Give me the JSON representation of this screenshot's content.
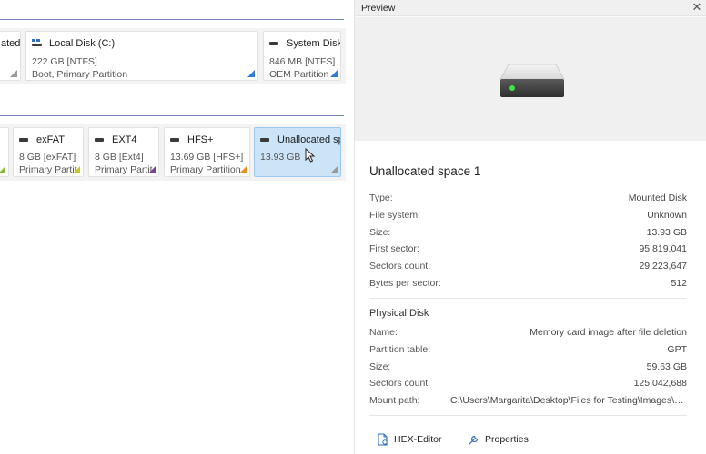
{
  "disk_map": {
    "disk1_partitions": [
      {
        "name": "",
        "line1": "ated",
        "line2": "",
        "icon": "drive-icon"
      },
      {
        "name": "Local Disk (C:)",
        "line1": "222 GB [NTFS]",
        "line2": "Boot, Primary Partition",
        "icon": "windows-drive-icon",
        "accent": "#2f7bd8"
      },
      {
        "name": "System Disk",
        "line1": "846 MB [NTFS]",
        "line2": "OEM Partition",
        "icon": "drive-icon",
        "accent": "#2f7bd8"
      }
    ],
    "disk2_partitions": [
      {
        "name": "",
        "line1": "",
        "line2": "",
        "accent": "#8ab83a"
      },
      {
        "name": "exFAT",
        "line1": "8 GB [exFAT]",
        "line2": "Primary Partit",
        "accent": "#c8c820"
      },
      {
        "name": "EXT4",
        "line1": "8 GB [Ext4]",
        "line2": "Primary Partit",
        "accent": "#7a3fa0"
      },
      {
        "name": "HFS+",
        "line1": "13.69 GB [HFS+]",
        "line2": "Primary Partition",
        "accent": "#e8901c"
      },
      {
        "name": "Unallocated sp",
        "line1": "13.93 GB",
        "line2": "",
        "accent": "#9a9a9a",
        "selected": true
      }
    ]
  },
  "preview": {
    "title": "Preview",
    "volume_name": "Unallocated space 1",
    "properties": [
      {
        "key": "Type:",
        "value": "Mounted Disk"
      },
      {
        "key": "File system:",
        "value": "Unknown"
      },
      {
        "key": "Size:",
        "value": "13.93 GB"
      },
      {
        "key": "First sector:",
        "value": "95,819,041"
      },
      {
        "key": "Sectors count:",
        "value": "29,223,647"
      },
      {
        "key": "Bytes per sector:",
        "value": "512"
      }
    ],
    "physical_disk_title": "Physical Disk",
    "physical_disk": [
      {
        "key": "Name:",
        "value": "Memory card image after file deletion"
      },
      {
        "key": "Partition table:",
        "value": "GPT"
      },
      {
        "key": "Size:",
        "value": "59.63 GB"
      },
      {
        "key": "Sectors count:",
        "value": "125,042,688"
      },
      {
        "key": "Mount path:",
        "value": "C:\\Users\\Margarita\\Desktop\\Files for Testing\\Images\\M..."
      }
    ],
    "actions": {
      "hex_editor": "HEX-Editor",
      "properties": "Properties"
    },
    "icons": {
      "close": "close-icon",
      "drive": "drive-icon",
      "hex": "hex-editor-icon",
      "wrench": "wrench-icon"
    }
  }
}
